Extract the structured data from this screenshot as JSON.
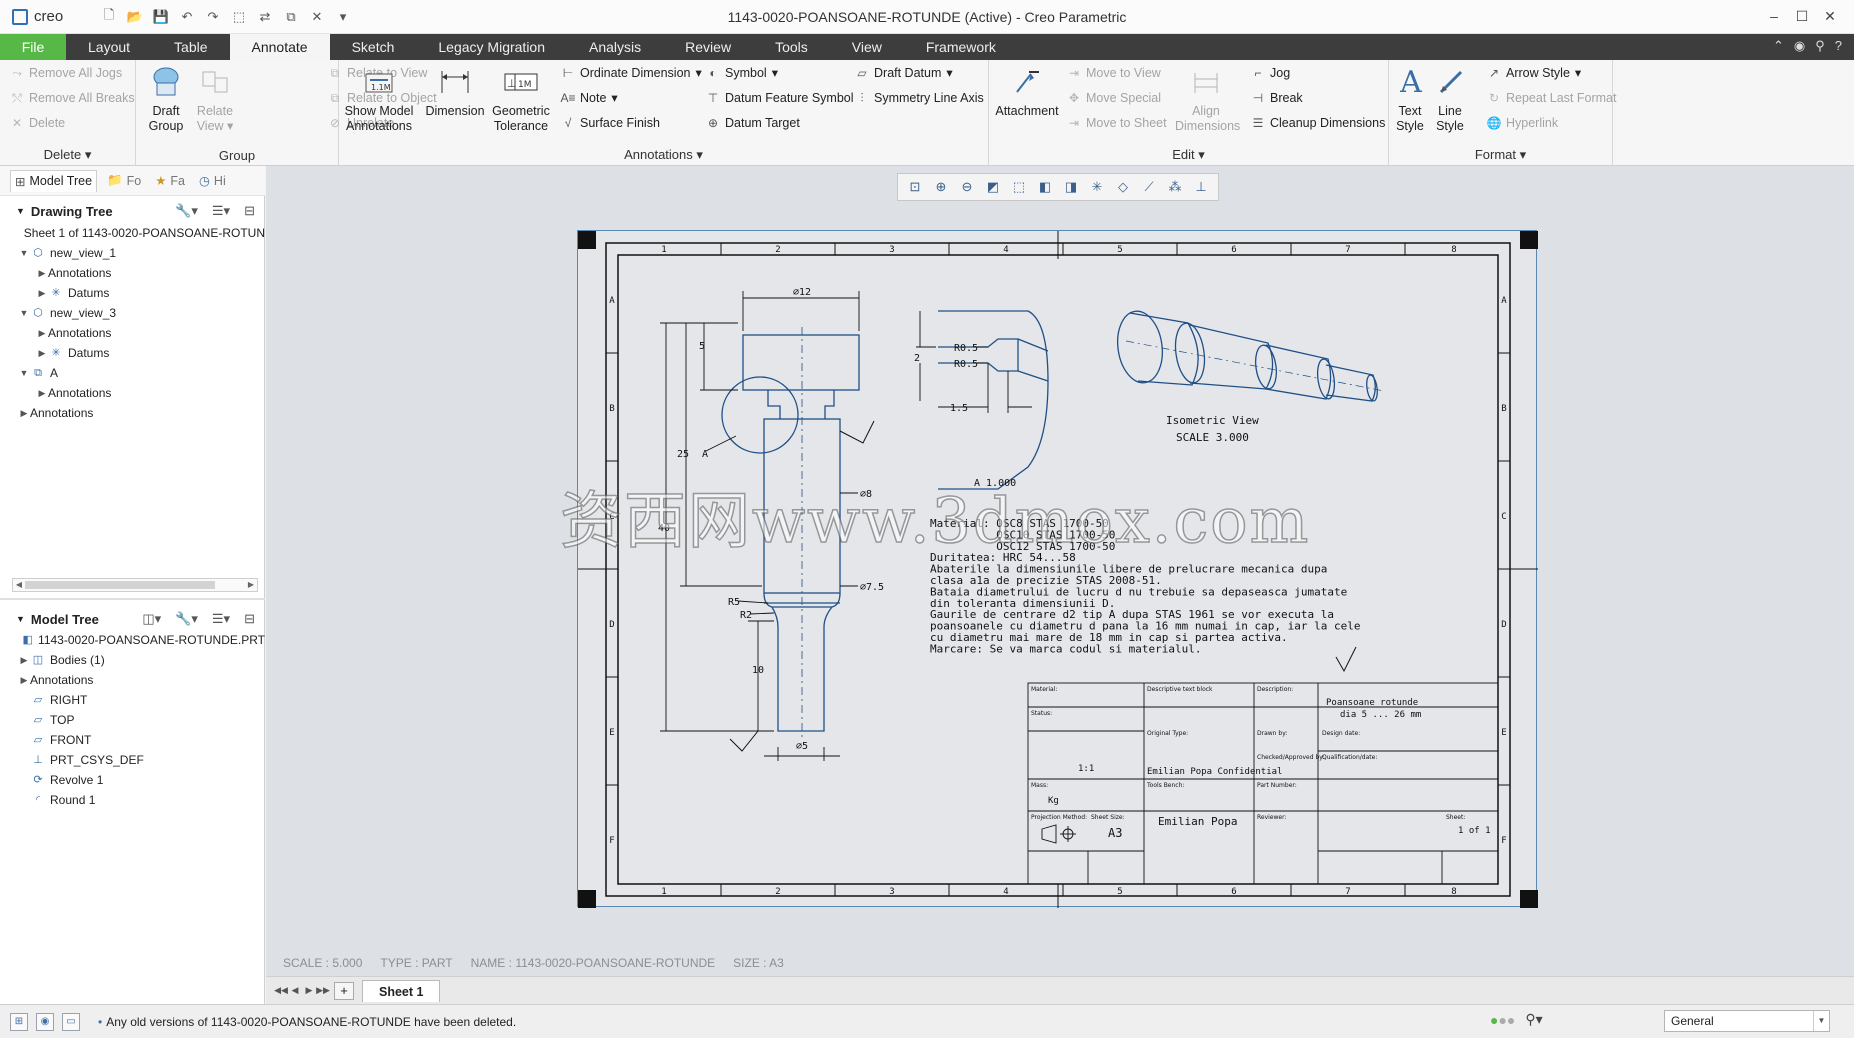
{
  "app": {
    "logo": "creo",
    "title": "1143-0020-POANSOANE-ROTUNDE (Active) - Creo Parametric"
  },
  "tabs": [
    "File",
    "Layout",
    "Table",
    "Annotate",
    "Sketch",
    "Legacy Migration",
    "Analysis",
    "Review",
    "Tools",
    "View",
    "Framework"
  ],
  "ribbon": {
    "delete_group": {
      "label": "Delete",
      "remove_all_jogs": "Remove All Jogs",
      "remove_all_breaks": "Remove All Breaks",
      "delete": "Delete"
    },
    "group_group": {
      "label": "Group",
      "draft_group": "Draft Group",
      "relate_view": "Relate View",
      "relate_to_view": "Relate to View",
      "relate_to_object": "Relate to Object",
      "unrelate": "Unrelate"
    },
    "annotations_group": {
      "label": "Annotations",
      "show_model_annotations": "Show Model Annotations",
      "dimension": "Dimension",
      "geometric_tolerance": "Geometric Tolerance",
      "ordinate_dimension": "Ordinate Dimension",
      "note": "Note",
      "surface_finish": "Surface Finish",
      "symbol": "Symbol",
      "datum_feature_symbol": "Datum Feature Symbol",
      "datum_target": "Datum Target",
      "draft_datum": "Draft Datum",
      "symmetry_line_axis": "Symmetry Line Axis"
    },
    "edit_group": {
      "label": "Edit",
      "attachment": "Attachment",
      "move_to_view": "Move to View",
      "move_special": "Move Special",
      "move_to_sheet": "Move to Sheet",
      "align_dimensions": "Align Dimensions",
      "jog": "Jog",
      "break": "Break",
      "cleanup_dimensions": "Cleanup Dimensions"
    },
    "format_group": {
      "label": "Format",
      "text_style": "Text Style",
      "line_style": "Line Style",
      "arrow_style": "Arrow Style",
      "repeat_last_format": "Repeat Last Format",
      "hyperlink": "Hyperlink"
    }
  },
  "left_panel": {
    "tabs": [
      "Model Tree",
      "Fo",
      "Fa",
      "Hi"
    ],
    "drawing_tree": {
      "title": "Drawing Tree",
      "items": [
        {
          "label": "Sheet 1 of 1143-0020-POANSOANE-ROTUN",
          "level": 0,
          "expand": ""
        },
        {
          "label": "new_view_1",
          "level": 0,
          "expand": "open"
        },
        {
          "label": "Annotations",
          "level": 1,
          "expand": "closed"
        },
        {
          "label": "Datums",
          "level": 1,
          "expand": "closed"
        },
        {
          "label": "new_view_3",
          "level": 0,
          "expand": "open"
        },
        {
          "label": "Annotations",
          "level": 1,
          "expand": "closed"
        },
        {
          "label": "Datums",
          "level": 1,
          "expand": "closed"
        },
        {
          "label": "A",
          "level": 0,
          "expand": "open"
        },
        {
          "label": "Annotations",
          "level": 1,
          "expand": "closed"
        },
        {
          "label": "Annotations",
          "level": -1,
          "expand": "closed"
        }
      ]
    },
    "model_tree": {
      "title": "Model Tree",
      "items": [
        {
          "label": "1143-0020-POANSOANE-ROTUNDE.PRT",
          "expand": ""
        },
        {
          "label": "Bodies (1)",
          "expand": "closed"
        },
        {
          "label": "Annotations",
          "expand": "closed"
        },
        {
          "label": "RIGHT",
          "expand": ""
        },
        {
          "label": "TOP",
          "expand": ""
        },
        {
          "label": "FRONT",
          "expand": ""
        },
        {
          "label": "PRT_CSYS_DEF",
          "expand": ""
        },
        {
          "label": "Revolve 1",
          "expand": ""
        },
        {
          "label": "Round 1",
          "expand": ""
        }
      ]
    }
  },
  "drawing": {
    "border_numbers": [
      "1",
      "2",
      "3",
      "4",
      "5",
      "6",
      "7",
      "8"
    ],
    "border_letters": [
      "A",
      "B",
      "C",
      "D",
      "E",
      "F"
    ],
    "dims": {
      "d12": "⌀12",
      "d5": "5",
      "d25": "25",
      "d40": "40",
      "d8": "⌀8",
      "d7_5": "⌀7.5",
      "r5": "R5",
      "r2": "R2",
      "d10": "10",
      "d5b": "⌀5",
      "a_label": "A",
      "r05a": "R0.5",
      "r05b": "R0.5",
      "d2": "2",
      "d1_5": "1.5",
      "detail_scale": "A 1.000"
    },
    "iso_label": "Isometric View",
    "iso_scale": "SCALE 3.000",
    "notes": [
      "Material: OSC8 STAS 1700-50",
      "          OSC10 STAS 1700-50",
      "          OSC12 STAS 1700-50",
      "Duritatea: HRC 54...58",
      "Abaterile la dimensiunile libere de prelucrare mecanica dupa",
      "clasa a1a de precizie STAS 2008-51.",
      "Bataia diametrului de lucru d nu trebuie sa depaseasca jumatate",
      "din toleranta dimensiunii D.",
      "Gaurile de centrare d2 tip A dupa STAS 1961 se vor executa la",
      "poansoanele cu diametru d pana la 16 mm numai in cap, iar la cele",
      "cu diametru mai mare de 18 mm in cap si partea activa.",
      "Marcare: Se va marca codul si materialul."
    ],
    "title_block": {
      "description_label": "Description:",
      "description": "Poansoane rotunde",
      "description2": "dia 5 ... 26 mm",
      "sheet_size": "A3",
      "designer": "Emilian Popa",
      "confidential": "Emilian Popa Confidential",
      "scale_val": "1:1",
      "mass_val": "Kg",
      "sheet_val": "1 of 1"
    },
    "watermark": "资西网www.3dmox.com"
  },
  "status_line": {
    "scale": "SCALE : 5.000",
    "type": "TYPE : PART",
    "name": "NAME : 1143-0020-POANSOANE-ROTUNDE",
    "size": "SIZE : A3"
  },
  "sheet_tab": "Sheet 1",
  "statusbar": {
    "message": "Any old versions of 1143-0020-POANSOANE-ROTUNDE have been deleted.",
    "filter": "General"
  },
  "colors": {
    "accent_file_tab": "#57b848",
    "tab_bar": "#3d3d3d",
    "drawing_lines": "#1f4f86",
    "sheet_frame": "#5a8ab4"
  }
}
